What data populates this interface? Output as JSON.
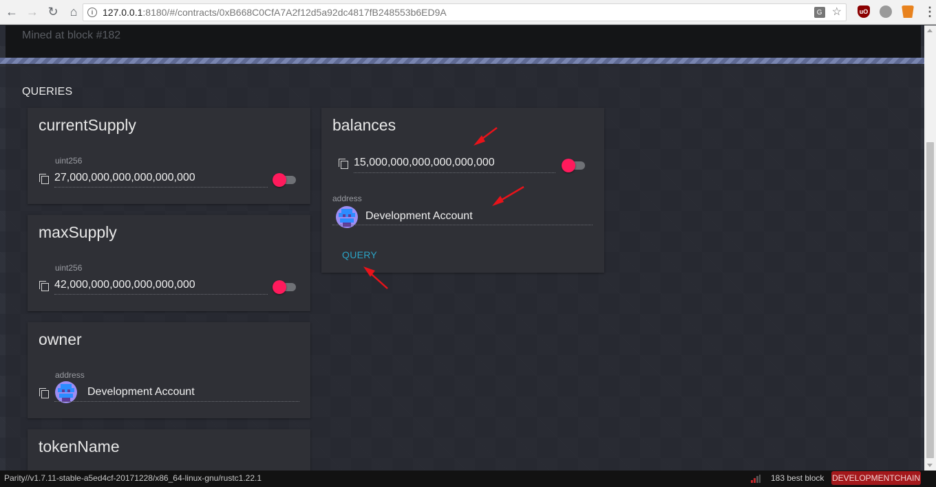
{
  "browser": {
    "url_host": "127.0.0.1",
    "url_rest": ":8180/#/contracts/0xB668C0CfA7A2f12d5a92dc4817fB248553b6ED9A",
    "back_icon": "arrow-left-icon",
    "forward_icon": "arrow-right-icon",
    "reload_icon": "reload-icon",
    "home_icon": "home-icon",
    "info_glyph": "i",
    "ublock_glyph": "uO"
  },
  "mined": {
    "text": "Mined at block #182"
  },
  "queries": {
    "title": "QUERIES",
    "cards": {
      "current_supply": {
        "title": "currentSupply",
        "type_label": "uint256",
        "value": "27,000,000,000,000,000,000"
      },
      "max_supply": {
        "title": "maxSupply",
        "type_label": "uint256",
        "value": "42,000,000,000,000,000,000"
      },
      "owner": {
        "title": "owner",
        "type_label": "address",
        "value": "Development Account"
      },
      "token_name": {
        "title": "tokenName"
      },
      "balances": {
        "title": "balances",
        "value": "15,000,000,000,000,000,000",
        "address_label": "address",
        "address_value": "Development Account",
        "query_button": "QUERY"
      }
    }
  },
  "status": {
    "version": "Parity//v1.7.11-stable-a5ed4cf-20171228/x86_64-linux-gnu/rustc1.22.1",
    "best_block": "183 best block",
    "chain": "DEVELOPMENTCHAIN"
  },
  "colors": {
    "accent_toggle": "#ff1a5c",
    "query_button": "#2ba4c6",
    "chain_badge": "#a4181b",
    "annotation_arrow": "#e8131a"
  }
}
